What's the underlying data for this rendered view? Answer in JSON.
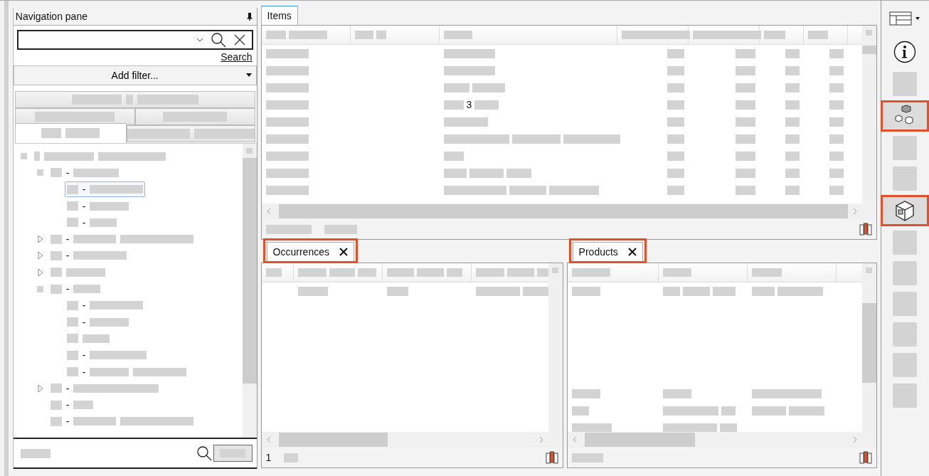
{
  "navigation_pane": {
    "title": "Navigation pane",
    "search": {
      "link": "Search"
    },
    "add_filter": {
      "label": "Add filter..."
    },
    "filter_tabs": [
      {
        "selected": false
      },
      {
        "selected": false
      },
      {
        "selected": false
      },
      {
        "selected": true
      },
      {
        "selected": false
      }
    ],
    "tree": [
      {
        "expanded": true,
        "selected": false,
        "children": [
          {
            "separator": "-",
            "expanded": true,
            "selected": false,
            "children": [
              {
                "separator": "-",
                "selected": true
              },
              {
                "separator": "-",
                "selected": false
              },
              {
                "separator": "-",
                "selected": false
              }
            ]
          },
          {
            "separator": "-",
            "expanded": false,
            "selected": false
          },
          {
            "separator": "-",
            "expanded": false,
            "selected": false
          },
          {
            "expanded": false,
            "selected": false
          },
          {
            "separator": "-",
            "expanded": true,
            "selected": false,
            "children": [
              {
                "separator": "-",
                "selected": false
              },
              {
                "separator": "-",
                "selected": false
              },
              {
                "selected": false
              },
              {
                "separator": "-",
                "selected": false
              },
              {
                "separator": "-",
                "selected": false
              }
            ]
          },
          {
            "separator": "-",
            "expanded": false,
            "selected": false
          },
          {
            "separator": "-",
            "selected": false
          },
          {
            "separator": "-",
            "selected": false
          }
        ]
      }
    ]
  },
  "items_panel": {
    "tab": {
      "label": "Items",
      "selected": true
    },
    "visible_cell": "3"
  },
  "occurrences_panel": {
    "tab": {
      "label": "Occurrences",
      "highlighted": true
    },
    "footer_count": "1"
  },
  "products_panel": {
    "tab": {
      "label": "Products",
      "highlighted": true
    }
  },
  "toolbar": [
    {
      "kind": "layout",
      "highlighted": false
    },
    {
      "kind": "info",
      "highlighted": false
    },
    {
      "kind": "masked",
      "highlighted": false
    },
    {
      "kind": "components",
      "highlighted": true
    },
    {
      "kind": "masked",
      "highlighted": false
    },
    {
      "kind": "masked",
      "highlighted": false
    },
    {
      "kind": "box",
      "highlighted": true
    },
    {
      "kind": "masked",
      "highlighted": false
    },
    {
      "kind": "masked",
      "highlighted": false
    },
    {
      "kind": "masked",
      "highlighted": false
    },
    {
      "kind": "masked",
      "highlighted": false
    },
    {
      "kind": "masked",
      "highlighted": false
    },
    {
      "kind": "masked",
      "highlighted": false
    }
  ]
}
